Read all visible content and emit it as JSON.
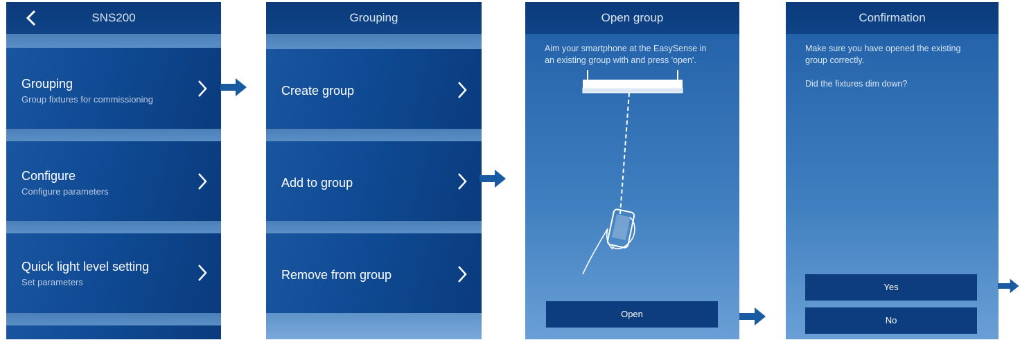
{
  "screen1": {
    "title": "SNS200",
    "items": [
      {
        "title": "Grouping",
        "subtitle": "Group fixtures for commissioning"
      },
      {
        "title": "Configure",
        "subtitle": "Configure parameters"
      },
      {
        "title": "Quick light level setting",
        "subtitle": "Set parameters"
      }
    ]
  },
  "screen2": {
    "title": "Grouping",
    "items": [
      {
        "title": "Create group"
      },
      {
        "title": "Add to group"
      },
      {
        "title": "Remove from group"
      }
    ]
  },
  "screen3": {
    "title": "Open group",
    "instruction": "Aim your smartphone at the EasySense in an existing group with and press 'open'.",
    "button": "Open"
  },
  "screen4": {
    "title": "Confirmation",
    "text1": "Make sure you have opened the existing group correctly.",
    "text2": "Did the fixtures dim down?",
    "yes": "Yes",
    "no": "No"
  },
  "icons": [
    "back-icon",
    "chevron-right-icon",
    "flow-arrow-icon",
    "ceiling-sensor-icon",
    "hand-smartphone-icon"
  ],
  "colors": {
    "header": "#0b3a7a",
    "item": "#0f4a93",
    "button": "#0d3d7e",
    "arrow": "#1a5aa0"
  }
}
